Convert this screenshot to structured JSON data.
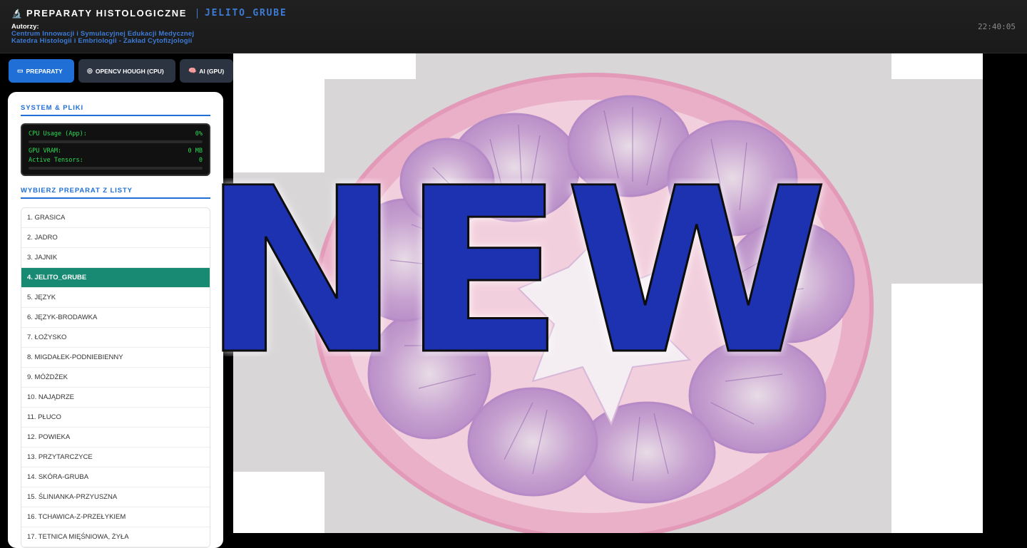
{
  "header": {
    "title": "PREPARATY HISTOLOGICZNE",
    "current_slide": "JELITO_GRUBE",
    "authors_label": "Autorzy:",
    "authors": [
      "Centrum Innowacji i Symulacyjnej Edukacji Medycznej",
      "Katedra Histologii i Embriologii - Zakład Cytofizjologii"
    ],
    "clock": "22:40:05",
    "icon": "microscope-icon"
  },
  "tabs": [
    {
      "label": "PREPARATY",
      "icon": "slides-icon",
      "active": true
    },
    {
      "label": "OPENCV HOUGH (CPU)",
      "icon": "target-icon",
      "active": false
    },
    {
      "label": "AI (GPU)",
      "icon": "brain-icon",
      "active": false
    }
  ],
  "system": {
    "title": "SYSTEM & PLIKI",
    "cpu_label": "CPU Usage (App):",
    "cpu_value": "0%",
    "vram_label": "GPU VRAM:",
    "vram_value": "0 MB",
    "tensors_label": "Active Tensors:",
    "tensors_value": "0"
  },
  "list": {
    "title": "WYBIERZ PREPARAT Z LISTY",
    "items": [
      "1. GRASICA",
      "2. JADRO",
      "3. JAJNIK",
      "4. JELITO_GRUBE",
      "5. JĘZYK",
      "6. JĘZYK-BRODAWKA",
      "7. ŁOŻYSKO",
      "8. MIGDAŁEK-PODNIEBIENNY",
      "9. MÓŻDŻEK",
      "10. NAJĄDRZE",
      "11. PŁUCO",
      "12. POWIEKA",
      "13. PRZYTARCZYCE",
      "14. SKÓRA-GRUBA",
      "15. ŚLINIANKA-PRZYUSZNA",
      "16. TCHAWICA-Z-PRZEŁYKIEM",
      "17. TETNICA MIĘŚNIOWA, ŻYŁA"
    ],
    "selected_index": 3
  },
  "overlay": {
    "text": "NEW",
    "fill": "#1a33b0",
    "stroke": "#0a0a0a"
  },
  "colors": {
    "accent": "#1f6fd6",
    "selected": "#188a74",
    "tissue_pink": "#e9a9c4",
    "tissue_purple": "#9a6bb5"
  }
}
